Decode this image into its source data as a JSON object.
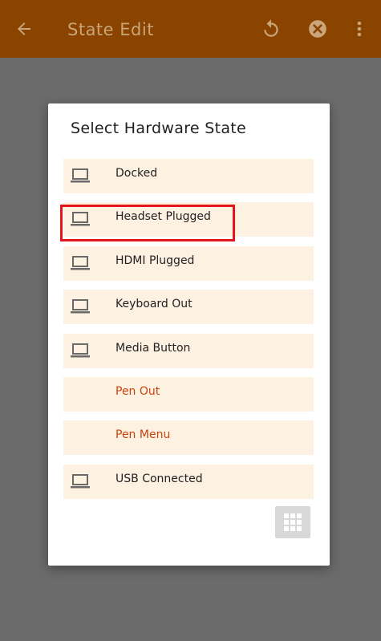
{
  "appbar": {
    "title": "State Edit",
    "icons": [
      "back-arrow-icon",
      "refresh-icon",
      "close-icon",
      "more-vert-icon"
    ]
  },
  "dialog": {
    "title": "Select Hardware State",
    "items": [
      {
        "label": "Docked",
        "icon": "laptop-icon"
      },
      {
        "label": "Headset Plugged",
        "icon": "laptop-icon"
      },
      {
        "label": "HDMI Plugged",
        "icon": "laptop-icon"
      },
      {
        "label": "Keyboard Out",
        "icon": "laptop-icon"
      },
      {
        "label": "Media Button",
        "icon": "laptop-icon"
      },
      {
        "label": "Pen Out",
        "icon": ""
      },
      {
        "label": "Pen Menu",
        "icon": ""
      },
      {
        "label": "USB Connected",
        "icon": "laptop-icon"
      }
    ],
    "grid_button_icon": "grid-icon"
  },
  "colors": {
    "appbar": "#8b4300",
    "item_bg": "#fdf1e2",
    "accent_text": "#c8430c",
    "highlight": "#e6141b"
  }
}
